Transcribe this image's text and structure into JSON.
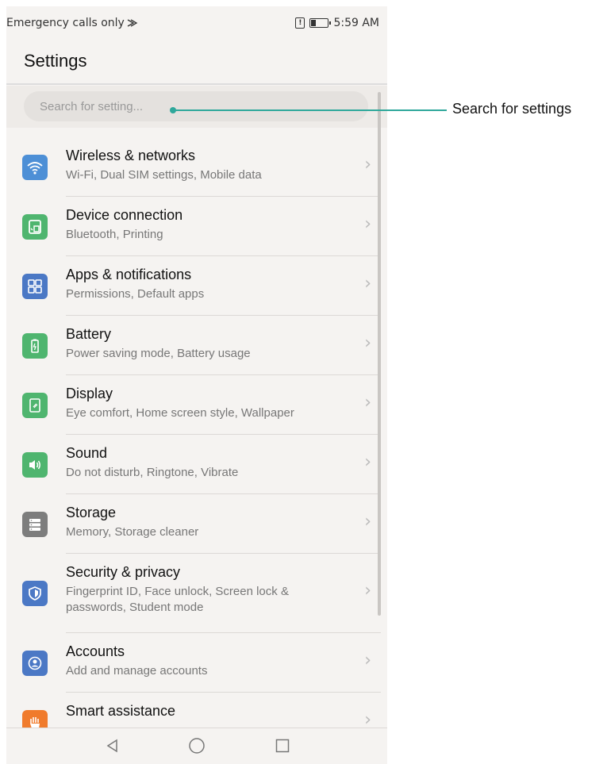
{
  "status_bar": {
    "carrier_text": "Emergency calls only",
    "time": "5:59 AM"
  },
  "page_title": "Settings",
  "search": {
    "placeholder": "Search for setting..."
  },
  "annotation": {
    "label": "Search for settings"
  },
  "colors": {
    "wireless": "#4d8fd6",
    "device": "#4fb56f",
    "apps": "#4b78c5",
    "battery": "#4fb56f",
    "display": "#4fb56f",
    "sound": "#4fb56f",
    "storage": "#7d7d7d",
    "security": "#4b78c5",
    "accounts": "#4b78c5",
    "smart": "#f07b2c",
    "accent": "#2fa89b"
  },
  "settings_items": [
    {
      "label": "Wireless & networks",
      "sub": "Wi-Fi, Dual SIM settings, Mobile data",
      "icon": "wifi-icon"
    },
    {
      "label": "Device connection",
      "sub": "Bluetooth, Printing",
      "icon": "device-connection-icon"
    },
    {
      "label": "Apps & notifications",
      "sub": "Permissions, Default apps",
      "icon": "apps-grid-icon"
    },
    {
      "label": "Battery",
      "sub": "Power saving mode, Battery usage",
      "icon": "battery-icon"
    },
    {
      "label": "Display",
      "sub": "Eye comfort, Home screen style, Wallpaper",
      "icon": "display-icon"
    },
    {
      "label": "Sound",
      "sub": "Do not disturb, Ringtone, Vibrate",
      "icon": "speaker-icon"
    },
    {
      "label": "Storage",
      "sub": "Memory, Storage cleaner",
      "icon": "storage-icon"
    },
    {
      "label": "Security & privacy",
      "sub": "Fingerprint ID, Face unlock, Screen lock & passwords, Student mode",
      "icon": "shield-icon"
    },
    {
      "label": "Accounts",
      "sub": "Add and manage accounts",
      "icon": "account-icon"
    },
    {
      "label": "Smart assistance",
      "sub": "",
      "icon": "hand-icon"
    }
  ],
  "nav_bar": {
    "icons": [
      "back-icon",
      "home-icon",
      "recents-icon"
    ]
  }
}
